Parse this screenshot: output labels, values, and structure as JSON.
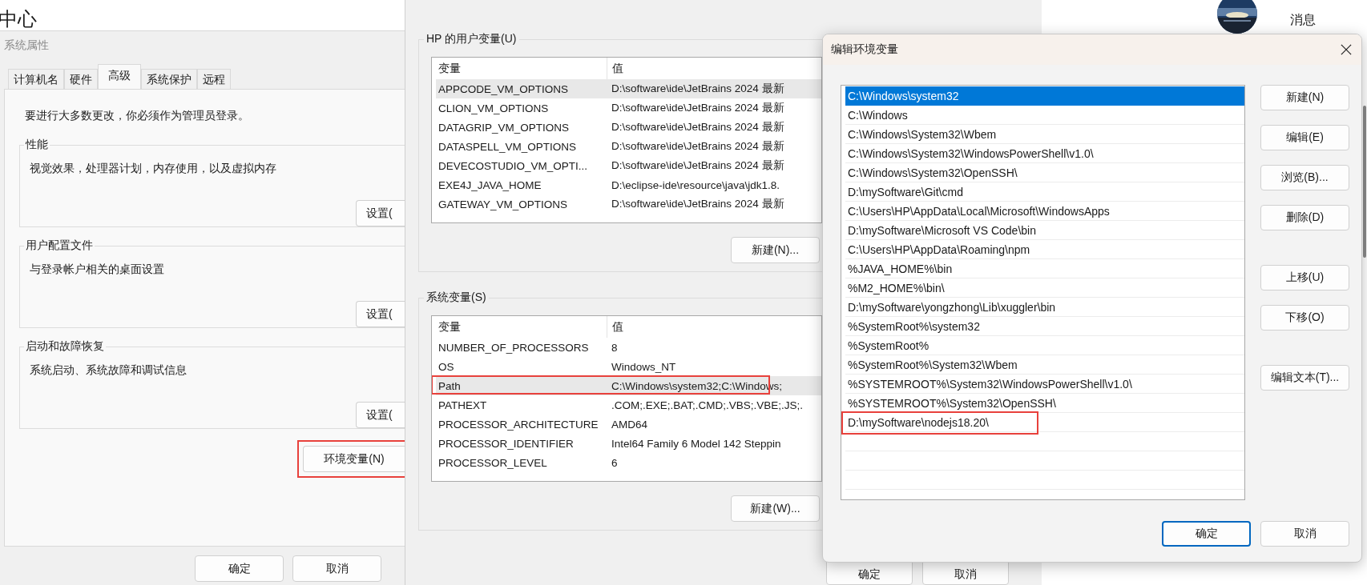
{
  "page_header": {
    "title": "中心",
    "messages_label": "消息"
  },
  "system_properties": {
    "title": "系统属性",
    "tabs": [
      {
        "label": "计算机名",
        "selected": false
      },
      {
        "label": "硬件",
        "selected": false
      },
      {
        "label": "高级",
        "selected": true
      },
      {
        "label": "系统保护",
        "selected": false
      },
      {
        "label": "远程",
        "selected": false
      }
    ],
    "admin_note": "要进行大多数更改，你必须作为管理员登录。",
    "groups": [
      {
        "title": "性能",
        "description": "视觉效果，处理器计划，内存使用，以及虚拟内存",
        "button": "设置("
      },
      {
        "title": "用户配置文件",
        "description": "与登录帐户相关的桌面设置",
        "button": "设置("
      },
      {
        "title": "启动和故障恢复",
        "description": "系统启动、系统故障和调试信息",
        "button": "设置("
      }
    ],
    "env_button": {
      "label": "环境变量(N)",
      "annotated": true
    },
    "buttons": [
      "确定",
      "取消"
    ]
  },
  "environment_variables": {
    "user_group": {
      "title": "HP 的用户变量(U)",
      "columns": [
        "变量",
        "值"
      ],
      "new_button": "新建(N)...",
      "rows": [
        {
          "name": "APPCODE_VM_OPTIONS",
          "value": "D:\\software\\ide\\JetBrains  2024 最新",
          "selected": true
        },
        {
          "name": "CLION_VM_OPTIONS",
          "value": "D:\\software\\ide\\JetBrains  2024 最新",
          "selected": false
        },
        {
          "name": "DATAGRIP_VM_OPTIONS",
          "value": "D:\\software\\ide\\JetBrains  2024 最新",
          "selected": false
        },
        {
          "name": "DATASPELL_VM_OPTIONS",
          "value": "D:\\software\\ide\\JetBrains  2024 最新",
          "selected": false
        },
        {
          "name": "DEVECOSTUDIO_VM_OPTI...",
          "value": "D:\\software\\ide\\JetBrains  2024 最新",
          "selected": false
        },
        {
          "name": "EXE4J_JAVA_HOME",
          "value": "D:\\eclipse-ide\\resource\\java\\jdk1.8.",
          "selected": false
        },
        {
          "name": "GATEWAY_VM_OPTIONS",
          "value": "D:\\software\\ide\\JetBrains  2024 最新",
          "selected": false
        }
      ]
    },
    "system_group": {
      "title": "系统变量(S)",
      "columns": [
        "变量",
        "值"
      ],
      "new_button": "新建(W)...",
      "rows": [
        {
          "name": "NUMBER_OF_PROCESSORS",
          "value": "8",
          "selected": false,
          "annotated": false
        },
        {
          "name": "OS",
          "value": "Windows_NT",
          "selected": false,
          "annotated": false
        },
        {
          "name": "Path",
          "value": "C:\\Windows\\system32;C:\\Windows;",
          "selected": true,
          "annotated": true
        },
        {
          "name": "PATHEXT",
          "value": ".COM;.EXE;.BAT;.CMD;.VBS;.VBE;.JS;.",
          "selected": false,
          "annotated": false
        },
        {
          "name": "PROCESSOR_ARCHITECTURE",
          "value": "AMD64",
          "selected": false,
          "annotated": false
        },
        {
          "name": "PROCESSOR_IDENTIFIER",
          "value": "Intel64 Family 6 Model 142 Steppin",
          "selected": false,
          "annotated": false
        },
        {
          "name": "PROCESSOR_LEVEL",
          "value": "6",
          "selected": false,
          "annotated": false
        }
      ]
    },
    "buttons": [
      "确定",
      "取消"
    ]
  },
  "edit_dialog": {
    "title": "编辑环境变量",
    "entries": [
      {
        "text": "C:\\Windows\\system32",
        "selected": true,
        "annotated": false
      },
      {
        "text": "C:\\Windows",
        "selected": false,
        "annotated": false
      },
      {
        "text": "C:\\Windows\\System32\\Wbem",
        "selected": false,
        "annotated": false
      },
      {
        "text": "C:\\Windows\\System32\\WindowsPowerShell\\v1.0\\",
        "selected": false,
        "annotated": false
      },
      {
        "text": "C:\\Windows\\System32\\OpenSSH\\",
        "selected": false,
        "annotated": false
      },
      {
        "text": "D:\\mySoftware\\Git\\cmd",
        "selected": false,
        "annotated": false
      },
      {
        "text": "C:\\Users\\HP\\AppData\\Local\\Microsoft\\WindowsApps",
        "selected": false,
        "annotated": false
      },
      {
        "text": "D:\\mySoftware\\Microsoft VS Code\\bin",
        "selected": false,
        "annotated": false
      },
      {
        "text": "C:\\Users\\HP\\AppData\\Roaming\\npm",
        "selected": false,
        "annotated": false
      },
      {
        "text": "%JAVA_HOME%\\bin",
        "selected": false,
        "annotated": false
      },
      {
        "text": "%M2_HOME%\\bin\\",
        "selected": false,
        "annotated": false
      },
      {
        "text": "D:\\mySoftware\\yongzhong\\Lib\\xuggler\\bin",
        "selected": false,
        "annotated": false
      },
      {
        "text": "%SystemRoot%\\system32",
        "selected": false,
        "annotated": false
      },
      {
        "text": "%SystemRoot%",
        "selected": false,
        "annotated": false
      },
      {
        "text": "%SystemRoot%\\System32\\Wbem",
        "selected": false,
        "annotated": false
      },
      {
        "text": "%SYSTEMROOT%\\System32\\WindowsPowerShell\\v1.0\\",
        "selected": false,
        "annotated": false
      },
      {
        "text": "%SYSTEMROOT%\\System32\\OpenSSH\\",
        "selected": false,
        "annotated": false
      },
      {
        "text": "D:\\mySoftware\\nodejs18.20\\",
        "selected": false,
        "annotated": true
      }
    ],
    "button_groups": [
      [
        "新建(N)",
        "编辑(E)",
        "浏览(B)...",
        "删除(D)"
      ],
      [
        "上移(U)",
        "下移(O)"
      ],
      [
        "编辑文本(T)..."
      ]
    ],
    "buttons": [
      {
        "label": "确定",
        "default": true
      },
      {
        "label": "取消",
        "default": false
      }
    ]
  }
}
